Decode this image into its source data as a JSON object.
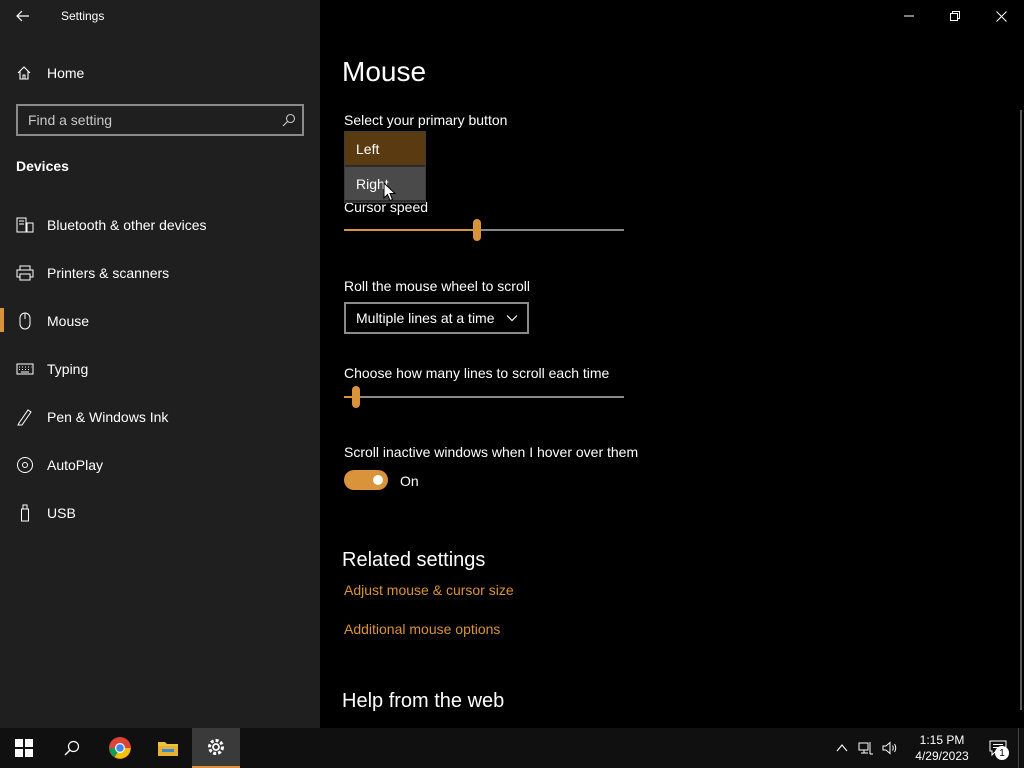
{
  "window": {
    "title": "Settings"
  },
  "sidebar": {
    "home_label": "Home",
    "search_placeholder": "Find a setting",
    "section_title": "Devices",
    "items": [
      {
        "label": "Bluetooth & other devices",
        "icon": "bluetooth-devices-icon"
      },
      {
        "label": "Printers & scanners",
        "icon": "printer-icon"
      },
      {
        "label": "Mouse",
        "icon": "mouse-icon",
        "selected": true
      },
      {
        "label": "Typing",
        "icon": "keyboard-icon"
      },
      {
        "label": "Pen & Windows Ink",
        "icon": "pen-icon"
      },
      {
        "label": "AutoPlay",
        "icon": "autoplay-icon"
      },
      {
        "label": "USB",
        "icon": "usb-icon"
      }
    ]
  },
  "main": {
    "title": "Mouse",
    "primary_button": {
      "label": "Select your primary button",
      "options": [
        "Left",
        "Right"
      ],
      "selected": "Left",
      "hovered": "Right"
    },
    "cursor_speed": {
      "label": "Cursor speed",
      "value_fraction": 0.475
    },
    "scroll_wheel": {
      "label": "Roll the mouse wheel to scroll",
      "value": "Multiple lines at a time"
    },
    "scroll_lines": {
      "label": "Choose how many lines to scroll each time",
      "value_fraction": 0.03
    },
    "inactive_scroll": {
      "label": "Scroll inactive windows when I hover over them",
      "state": "On"
    },
    "related": {
      "title": "Related settings",
      "links": [
        "Adjust mouse & cursor size",
        "Additional mouse options"
      ]
    },
    "help": {
      "title": "Help from the web"
    }
  },
  "taskbar": {
    "time": "1:15 PM",
    "date": "4/29/2023",
    "notification_count": "1"
  },
  "colors": {
    "accent": "#d9933a",
    "sidebar_bg": "#1f1f1f",
    "main_bg": "#000000"
  }
}
